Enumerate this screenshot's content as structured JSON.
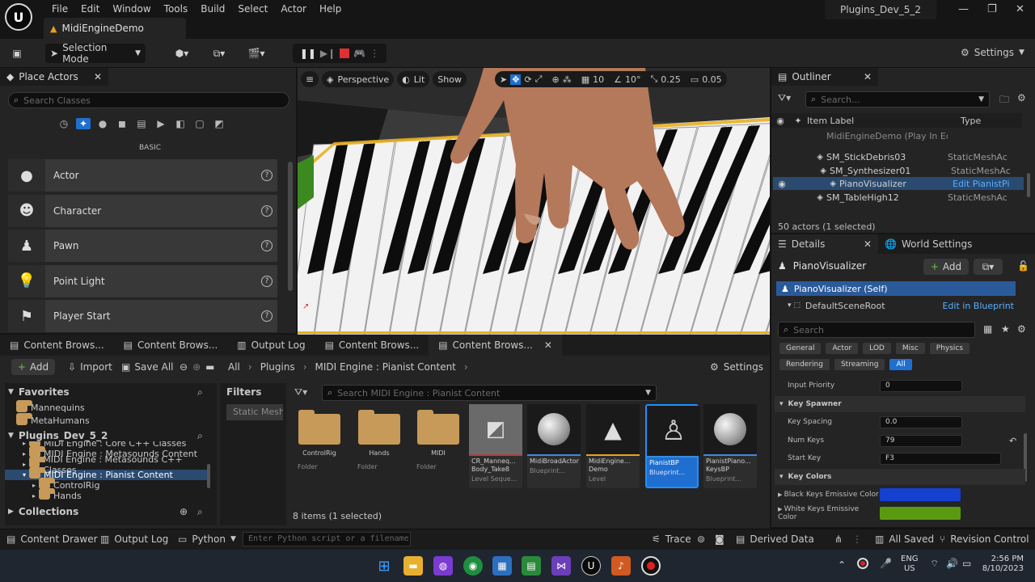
{
  "app": {
    "menu": [
      "File",
      "Edit",
      "Window",
      "Tools",
      "Build",
      "Select",
      "Actor",
      "Help"
    ],
    "project_tab": "MidiEngineDemo",
    "window_name": "Plugins_Dev_5_2"
  },
  "toolbar": {
    "selection_mode": "Selection Mode",
    "settings": "Settings"
  },
  "place_actors": {
    "title": "Place Actors",
    "search_placeholder": "Search Classes",
    "category": "BASIC",
    "items": [
      "Actor",
      "Character",
      "Pawn",
      "Point Light",
      "Player Start"
    ]
  },
  "viewport": {
    "perspective": "Perspective",
    "lit": "Lit",
    "show": "Show",
    "grid": "10",
    "angle": "10°",
    "scale": "0.25",
    "camera": "0.05"
  },
  "outliner": {
    "title": "Outliner",
    "search_placeholder": "Search...",
    "col_label": "Item Label",
    "col_type": "Type",
    "rows": [
      {
        "label": "MidiEngineDemo (Play In Editor)",
        "type": ""
      },
      {
        "label": "SM_StickDebris03",
        "type": "StaticMeshAc"
      },
      {
        "label": "SM_Synthesizer01",
        "type": "StaticMeshAc"
      },
      {
        "label": "PianoVisualizer",
        "type": "Edit PianistPi"
      },
      {
        "label": "SM_TableHigh12",
        "type": "StaticMeshAc"
      }
    ],
    "footer": "50 actors (1 selected)"
  },
  "details": {
    "tab_details": "Details",
    "tab_world": "World Settings",
    "actor_name": "PianoVisualizer",
    "add": "Add",
    "self_row": "PianoVisualizer (Self)",
    "root_row": "DefaultSceneRoot",
    "edit_bp": "Edit in Blueprint",
    "search_placeholder": "Search",
    "filters1": [
      "General",
      "Actor",
      "LOD",
      "Misc",
      "Physics"
    ],
    "filters2": [
      "Rendering",
      "Streaming",
      "All"
    ],
    "input_priority_label": "Input Priority",
    "input_priority": "0",
    "key_spawner": "Key Spawner",
    "key_spacing_label": "Key Spacing",
    "key_spacing": "0.0",
    "num_keys_label": "Num Keys",
    "num_keys": "79",
    "start_key_label": "Start Key",
    "start_key": "F3",
    "key_colors": "Key Colors",
    "black_keys_label": "Black Keys Emissive Color",
    "white_keys_label": "White Keys Emissive Color",
    "black_color": "#1540d0",
    "white_color": "#5a9a10"
  },
  "content_browser": {
    "tabs": [
      "Content Brows...",
      "Content Brows...",
      "Output Log",
      "Content Brows...",
      "Content Brows..."
    ],
    "add": "Add",
    "import": "Import",
    "save_all": "Save All",
    "crumbs": [
      "All",
      "Plugins",
      "MIDI Engine : Pianist Content"
    ],
    "settings": "Settings",
    "favorites": "Favorites",
    "fav_items": [
      "Mannequins",
      "MetaHumans"
    ],
    "project": "Plugins_Dev_5_2",
    "tree": [
      "MIDI Engine : Core C++ Classes",
      "MIDI Engine : Metasounds Content",
      "MIDI Engine : Metasounds C++ Classes",
      "MIDI Engine : Pianist Content",
      "ControlRig",
      "Hands"
    ],
    "collections": "Collections",
    "filters": "Filters",
    "static_mesh": "Static Mesh",
    "search_placeholder": "Search MIDI Engine : Pianist Content",
    "assets": [
      {
        "name": "ControlRig",
        "type": "Folder"
      },
      {
        "name": "Hands",
        "type": "Folder"
      },
      {
        "name": "MIDI",
        "type": "Folder"
      },
      {
        "name": "CR_Manneq... Body_Take8",
        "type": "Level Seque..."
      },
      {
        "name": "MidiBroadActor",
        "type": "Blueprint..."
      },
      {
        "name": "MidiEngine... Demo",
        "type": "Level"
      },
      {
        "name": "PianistBP",
        "type": "Blueprint..."
      },
      {
        "name": "PianistPiano... KeysBP",
        "type": "Blueprint..."
      }
    ],
    "count": "8 items (1 selected)"
  },
  "statusbar": {
    "content_drawer": "Content Drawer",
    "output_log": "Output Log",
    "python": "Python",
    "cmd_placeholder": "Enter Python script or a filename",
    "trace": "Trace",
    "derived": "Derived Data",
    "saved": "All Saved",
    "revision": "Revision Control"
  },
  "taskbar": {
    "lang1": "ENG",
    "lang2": "US",
    "time": "2:56 PM",
    "date": "8/10/2023"
  }
}
